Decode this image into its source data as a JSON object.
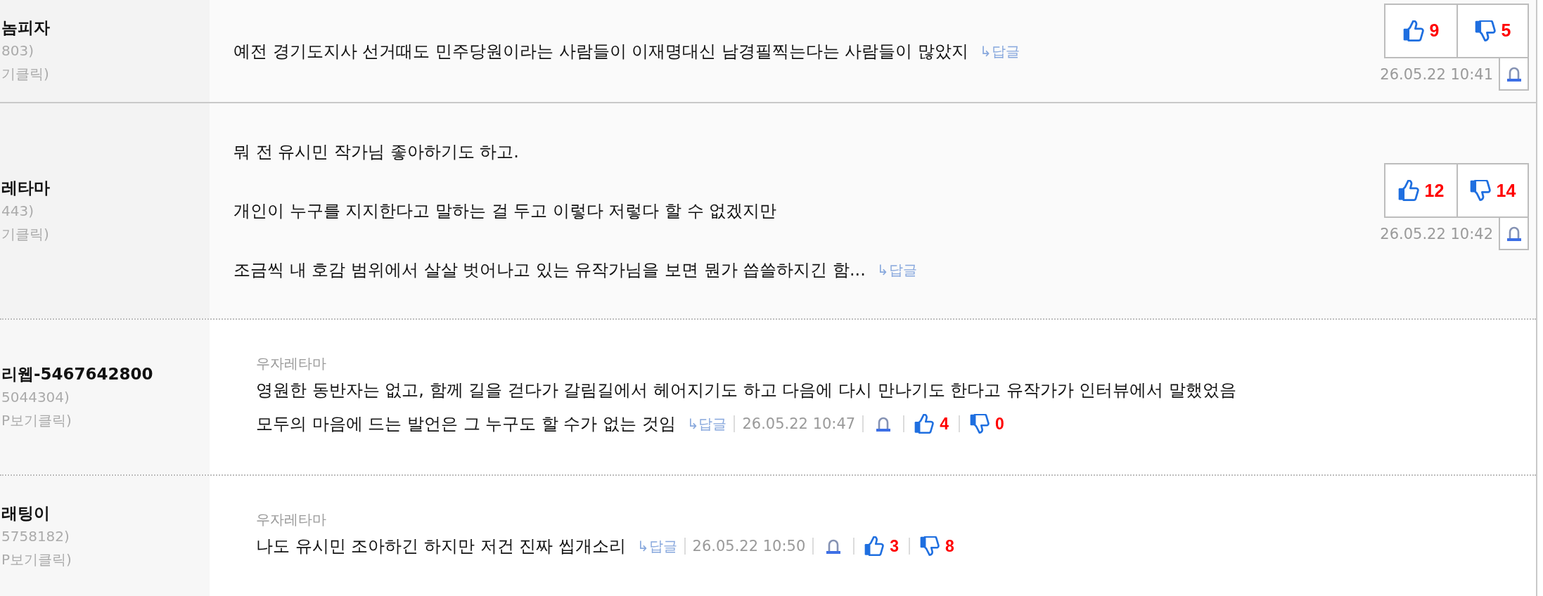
{
  "comments": [
    {
      "kind": "comment",
      "user": {
        "name": "놈피자",
        "code": "803)",
        "ip_link": "기클릭)"
      },
      "lines": [
        "예전 경기도지사 선거때도 민주당원이라는 사람들이 이재명대신 남경필찍는다는 사람들이 많았지"
      ],
      "reply_link": "↳답글",
      "likes": "9",
      "dislikes": "5",
      "date": "26.05.22 10:41"
    },
    {
      "kind": "comment",
      "user": {
        "name": "레타마",
        "code": "443)",
        "ip_link": "기클릭)"
      },
      "paragraphs": [
        "뭐 전 유시민 작가님 좋아하기도 하고.",
        "개인이 누구를 지지한다고 말하는 걸 두고 이렇다 저렇다 할 수 없겠지만",
        "조금씩 내 호감 범위에서 살살 벗어나고 있는 유작가님을 보면 뭔가 씁쓸하지긴 함..."
      ],
      "reply_link": "↳답글",
      "likes": "12",
      "dislikes": "14",
      "date": "26.05.22 10:42"
    },
    {
      "kind": "reply",
      "user": {
        "name": "리웹-5467642800",
        "code": "5044304)",
        "ip_link": "P보기클릭)"
      },
      "reply_to": "우자레타마",
      "lines": [
        "영원한 동반자는 없고, 함께 길을 걷다가 갈림길에서 헤어지기도 하고 다음에 다시 만나기도 한다고 유작가가 인터뷰에서 말했었음",
        "모두의 마음에 드는 발언은 그 누구도 할 수가 없는 것임"
      ],
      "reply_link": "↳답글",
      "date": "26.05.22 10:47",
      "likes": "4",
      "dislikes": "0"
    },
    {
      "kind": "reply",
      "user": {
        "name": "래팅이",
        "code": "5758182)",
        "ip_link": "P보기클릭)"
      },
      "reply_to": "우자레타마",
      "lines": [
        "나도 유시민 조아하긴 하지만 저건 진짜 씹개소리"
      ],
      "reply_link": "↳답글",
      "date": "26.05.22 10:50",
      "likes": "3",
      "dislikes": "8"
    }
  ]
}
